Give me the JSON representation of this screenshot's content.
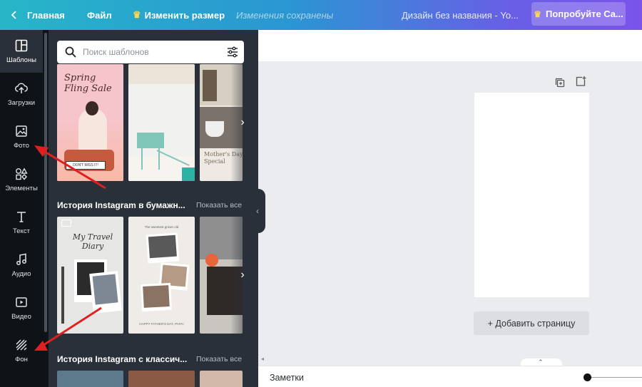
{
  "topbar": {
    "home_label": "Главная",
    "file_label": "Файл",
    "resize_label": "Изменить размер",
    "saved_label": "Изменения сохранены",
    "doc_title": "Дизайн без названия - Yo...",
    "try_label": "Попробуйте Ca..."
  },
  "leftnav": {
    "items": [
      {
        "label": "Шаблоны",
        "icon": "templates-icon"
      },
      {
        "label": "Загрузки",
        "icon": "upload-icon"
      },
      {
        "label": "Фото",
        "icon": "photo-icon"
      },
      {
        "label": "Элементы",
        "icon": "elements-icon"
      },
      {
        "label": "Текст",
        "icon": "text-icon"
      },
      {
        "label": "Аудио",
        "icon": "audio-icon"
      },
      {
        "label": "Видео",
        "icon": "video-icon"
      },
      {
        "label": "Фон",
        "icon": "background-icon"
      }
    ]
  },
  "panel": {
    "search_placeholder": "Поиск шаблонов",
    "templates_row1": {
      "thumb1_line1": "Spring",
      "thumb1_line2": "Fling Sale",
      "thumb1_tag": "DON'T MISS IT!",
      "thumb3_line1": "Mother's Day",
      "thumb3_line2": "Special"
    },
    "sections": [
      {
        "title": "История Instagram в бумажн...",
        "show_all": "Показать все"
      },
      {
        "title": "История Instagram с классич...",
        "show_all": "Показать все"
      }
    ],
    "templates_row2": {
      "thumb1_line1": "My Travel",
      "thumb1_line2": "Diary",
      "thumb2_caption": "HAPPY FATHER'S DAY, PAPA!",
      "thumb2_header": "The sweetest grown old"
    }
  },
  "canvas": {
    "add_page_label": "+ Добавить страницу"
  },
  "bottombar": {
    "notes_label": "Заметки"
  },
  "colors": {
    "accent": "#7b54ea",
    "panel_bg": "#293039",
    "nav_bg": "#0e1318",
    "annotation_arrow": "#e02020"
  }
}
